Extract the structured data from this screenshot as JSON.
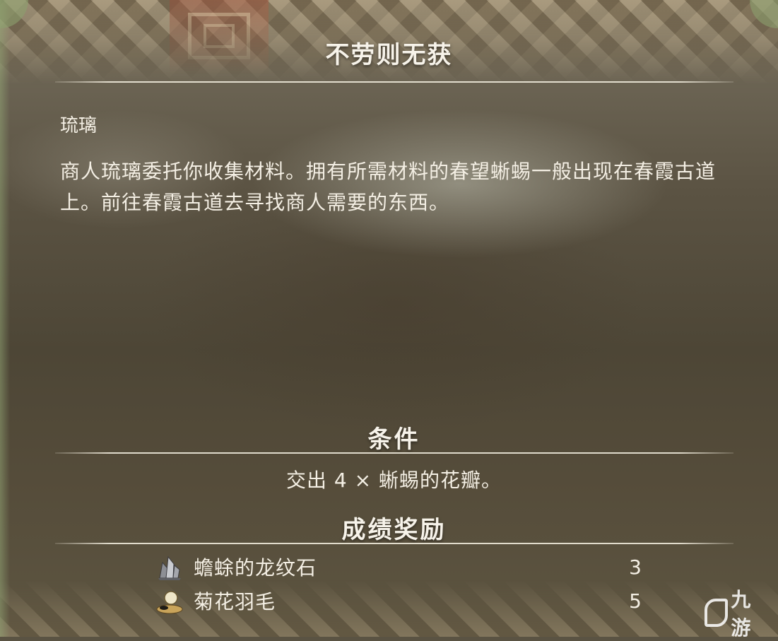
{
  "quest": {
    "title": "不劳则无获",
    "giver": "琉璃",
    "description": "商人琉璃委托你收集材料。拥有所需材料的春望蜥蜴一般出现在春霞古道上。前往春霞古道去寻找商人需要的东西。"
  },
  "conditions": {
    "heading": "条件",
    "text": "交出 4 × 蜥蜴的花瓣。"
  },
  "rewards": {
    "heading": "成绩奖励",
    "items": [
      {
        "icon": "crystal-ore-icon",
        "name": "蟾蜍的龙纹石",
        "quantity": "3"
      },
      {
        "icon": "chrysanthemum-feather-icon",
        "name": "菊花羽毛",
        "quantity": "5"
      }
    ]
  },
  "watermark": {
    "logo": "九游"
  },
  "colors": {
    "text": "#f4efe4",
    "rule": "#f0ebdc",
    "panel": "#554c3a"
  }
}
